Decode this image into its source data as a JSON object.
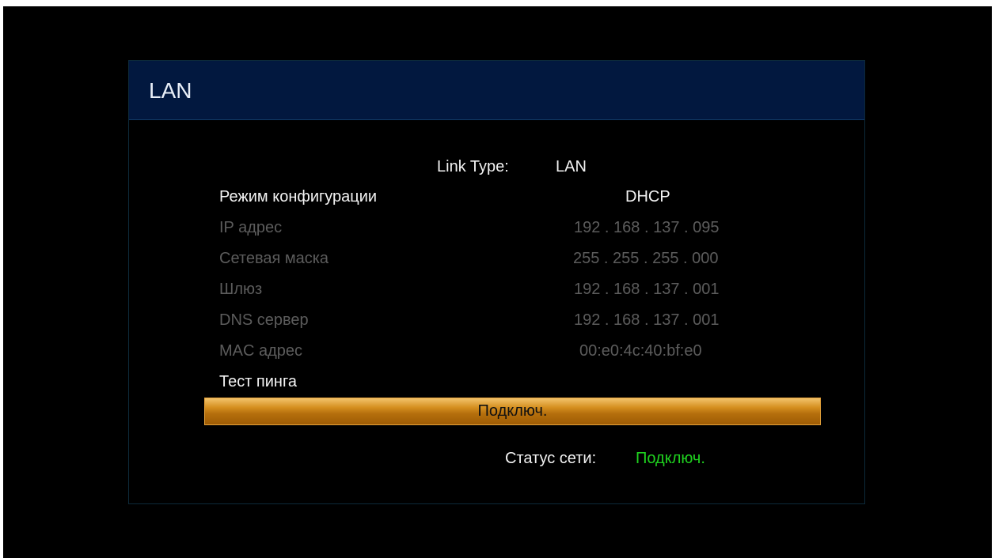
{
  "header": {
    "title": "LAN"
  },
  "link_type": {
    "label": "Link Type:",
    "value": "LAN"
  },
  "settings": [
    {
      "label": "Режим конфигурации",
      "value": "DHCP"
    },
    {
      "label": "IP адрес",
      "value": "192 . 168 . 137 . 095"
    },
    {
      "label": "Сетевая маска",
      "value": "255 . 255 . 255 . 000"
    },
    {
      "label": "Шлюз",
      "value": "192 . 168 . 137 . 001"
    },
    {
      "label": "DNS сервер",
      "value": "192 . 168 . 137 . 001"
    },
    {
      "label": "MAC адрес",
      "value": "00:e0:4c:40:bf:e0"
    },
    {
      "label": "Тест пинга",
      "value": ""
    }
  ],
  "connect_button": {
    "label": "Подключ."
  },
  "status": {
    "label": "Статус сети:",
    "value": "Подключ."
  },
  "colors": {
    "title_bar": "#02183f",
    "highlight": "#d58f1f",
    "status_ok": "#1fd21f",
    "dim_text": "#5c5c5c"
  }
}
